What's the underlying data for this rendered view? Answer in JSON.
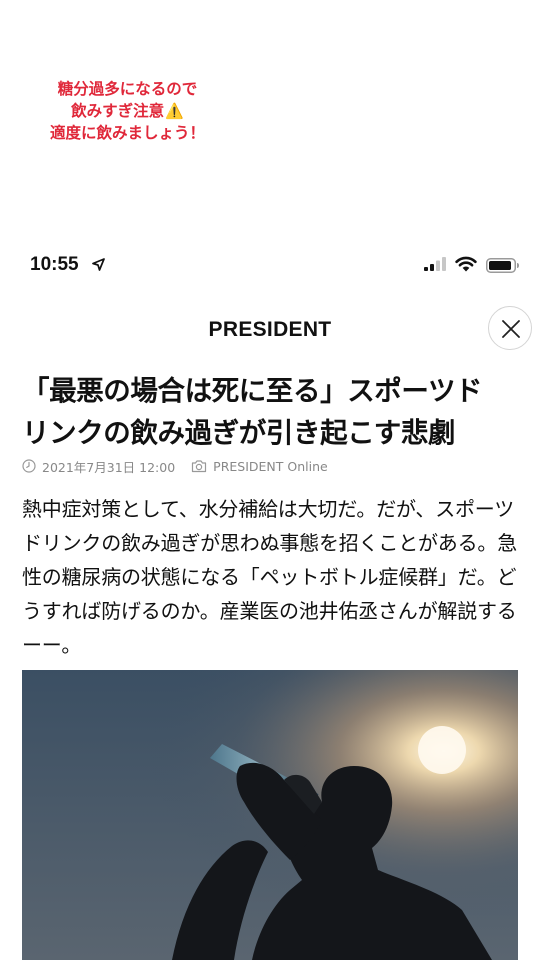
{
  "overlay_note": {
    "line1": "糖分過多になるので",
    "line2": "飲みすぎ注意",
    "warning_glyph": "⚠️",
    "line3": "適度に飲みましょう！"
  },
  "status_bar": {
    "time": "10:55"
  },
  "header": {
    "brand": "PRESIDENT"
  },
  "article": {
    "title_line1": "「最悪の場合は死に至る」スポーツド",
    "title_line2": "リンクの飲み過ぎが引き起こす悲劇",
    "date": "2021年7月31日 12:00",
    "source": "PRESIDENT Online",
    "lead": "熱中症対策として、水分補給は大切だ。だが、スポーツドリンクの飲み過ぎが思わぬ事態を招くことがある。急性の糖尿病の状態になる「ペットボトル症候群」だ。どうすれば防げるのか。産業医の池井佑丞さんが解説するーー。"
  },
  "colors": {
    "note_red": "#e0283a",
    "meta_gray": "#888888"
  }
}
